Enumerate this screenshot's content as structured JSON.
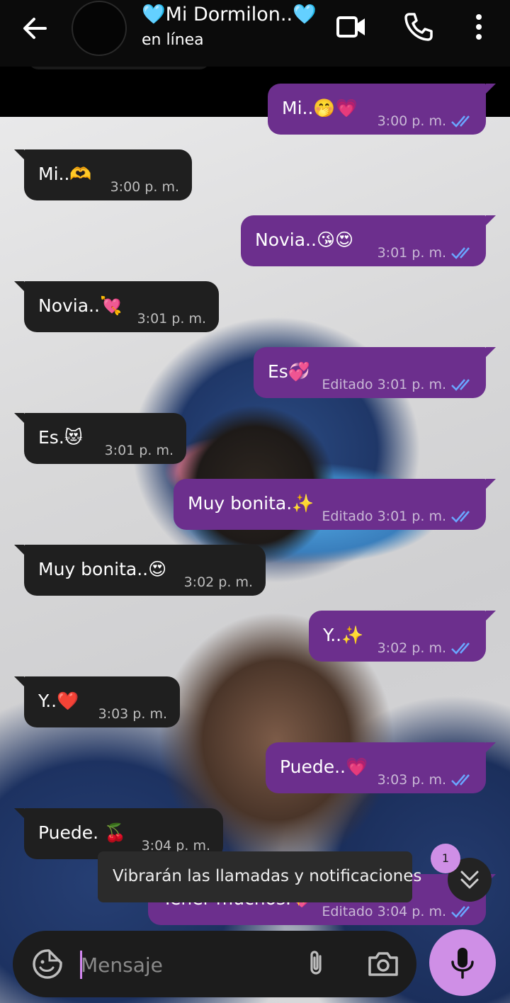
{
  "header": {
    "contact_name": "🩵Mi Dormilon..🩵",
    "status": "en línea"
  },
  "messages": [
    {
      "side": "out",
      "text": "Mi..🤭💗",
      "edited": "",
      "time": "3:00 p. m."
    },
    {
      "side": "in",
      "text": "Mi..🫶",
      "edited": "",
      "time": "3:00 p. m."
    },
    {
      "side": "out",
      "text": "Novia..😘😍",
      "edited": "",
      "time": "3:01 p. m."
    },
    {
      "side": "in",
      "text": "Novia..💘",
      "edited": "",
      "time": "3:01 p. m."
    },
    {
      "side": "out",
      "text": "Es💞",
      "edited": "Editado",
      "time": "3:01 p. m."
    },
    {
      "side": "in",
      "text": "Es.😻",
      "edited": "",
      "time": "3:01 p. m."
    },
    {
      "side": "out",
      "text": "Muy bonita.✨",
      "edited": "Editado",
      "time": "3:01 p. m."
    },
    {
      "side": "in",
      "text": "Muy bonita..😍",
      "edited": "",
      "time": "3:02 p. m."
    },
    {
      "side": "out",
      "text": "Y..✨",
      "edited": "",
      "time": "3:02 p. m."
    },
    {
      "side": "in",
      "text": "Y..❤️",
      "edited": "",
      "time": "3:03 p. m."
    },
    {
      "side": "out",
      "text": "Puede..💗",
      "edited": "",
      "time": "3:03 p. m."
    },
    {
      "side": "in",
      "text": "Puede. 🍒",
      "edited": "",
      "time": "3:04 p. m."
    },
    {
      "side": "out",
      "text": "Tener muchos.💖",
      "edited": "Editado",
      "time": "3:04 p. m."
    }
  ],
  "snackbar": {
    "text": "Vibrarán las llamadas y notificaciones"
  },
  "unread_badge": "1",
  "composer": {
    "placeholder": "Mensaje"
  },
  "colors": {
    "outgoing_bubble": "#6c2f8d",
    "incoming_bubble": "#1f1f1f",
    "read_ticks": "#6aa6ff",
    "accent": "#cf8fe6"
  },
  "icons": [
    "back-arrow-icon",
    "video-call-icon",
    "phone-icon",
    "more-vert-icon",
    "sticker-icon",
    "attach-icon",
    "camera-icon",
    "mic-icon",
    "double-chevron-down-icon",
    "double-check-icon"
  ]
}
